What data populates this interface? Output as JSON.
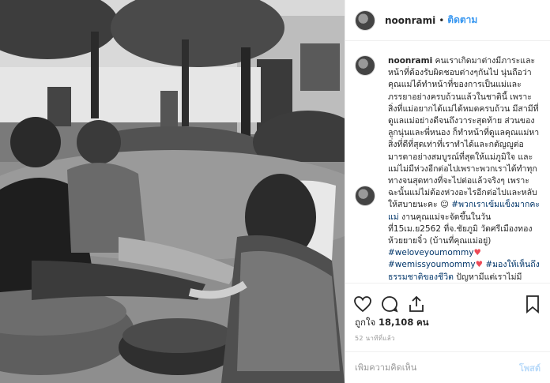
{
  "post": {
    "username": "noonrami",
    "dot": "•",
    "follow_label": "ติดตาม"
  },
  "caption": {
    "user": "noonrami",
    "text1": "คนเราเกิดมาต่างมีภาระและหน้าที่ต้องรับผิดชอบต่างๆกันไป นุ่นถือว่าคุณแม่ได้ทำหน้าที่ของการเป็นแม่และภรรยาอย่างครบถ้วนแล้วในชาตินี้ เพราะสิ่งที่แม่อยากได้แม่ได้หมดครบถ้วน มีสามีที่ดูแลแม่อย่างดีจนถึงวาระสุดท้าย ส่วนของลูกนุ่นและพี่หนอง ก็ทำหน้าที่ดูแลคุณแม่หาสิ่งที่ดีที่สุดเท่าที่เราทำได้และกตัญญูต่อมารดาอย่างสมบูรณ์ที่สุดให้แม่ภูมิใจ และแม่ไม่มีห่วงอีกต่อไปเพราะพวกเราได้ทำทุกทางจนสุดทางที่จะไปต่อแล้วจริงๆ เพราะฉะนั้นแม่ไม่ต้องห่วงอะไรอีกต่อไปและหลับให้สบายนะคะ",
    "emoji1": "☺",
    "tag1": "#พวกเราเข้มแข็งมากคะแม่",
    "text2": "งานคุณแม่จะจัดขึ้นในวันที่15เม.ย2562 ที่จ.ชัยภูมิ วัดศรีเมืองทองห้วยยายจิ๋ว (บ้านที่คุณแม่อยู่)",
    "tag2": "#weloveyoumommy",
    "heart1": "♥",
    "tag3": "#wemissyoumommy",
    "heart2": "♥",
    "tag4": "#มองให้เห็นถึงธรรมชาติของชีวิต",
    "text3": "ปัญหามีแต่เราไม่มีปัญหาก็หมดสิ้นปี"
  },
  "actions": {
    "like_icon": "heart-outline-icon",
    "comment_icon": "comment-bubble-icon",
    "share_icon": "share-upload-icon",
    "save_icon": "bookmark-icon"
  },
  "likes": {
    "prefix": "ถูกใจ",
    "count": "18,108",
    "suffix": "คน"
  },
  "timestamp": "52 นาทีที่แล้ว",
  "add_comment": {
    "placeholder": "เพิ่มความคิดเห็น",
    "post_label": "โพสต์"
  },
  "colors": {
    "link_blue": "#3897f0",
    "hashtag": "#003569",
    "heart_red": "#ed4956",
    "muted": "#999999"
  }
}
